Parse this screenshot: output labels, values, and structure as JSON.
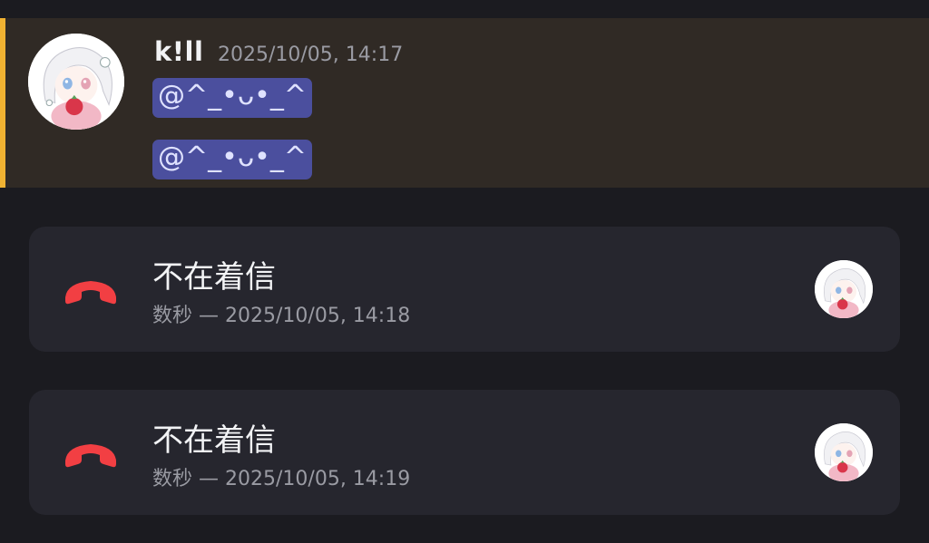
{
  "message": {
    "author": "k!ll",
    "timestamp": "2025/10/05, 14:17",
    "mentions": [
      "@^_•ᴗ•_^",
      "@^_•ᴗ•_^"
    ]
  },
  "calls": [
    {
      "status": "不在着信",
      "duration": "数秒",
      "separator": "—",
      "time": "2025/10/05, 14:18"
    },
    {
      "status": "不在着信",
      "duration": "数秒",
      "separator": "—",
      "time": "2025/10/05, 14:19"
    }
  ],
  "colors": {
    "background": "#1b1b20",
    "highlight": "#302a25",
    "mention_bar": "#f0b232",
    "mention_pill": "#4b4f9e",
    "card": "#26262e",
    "missed_call_red": "#f23f43"
  },
  "icons": {
    "missed_call": "phone-hangup-icon",
    "avatar": "anime-girl-avatar"
  }
}
